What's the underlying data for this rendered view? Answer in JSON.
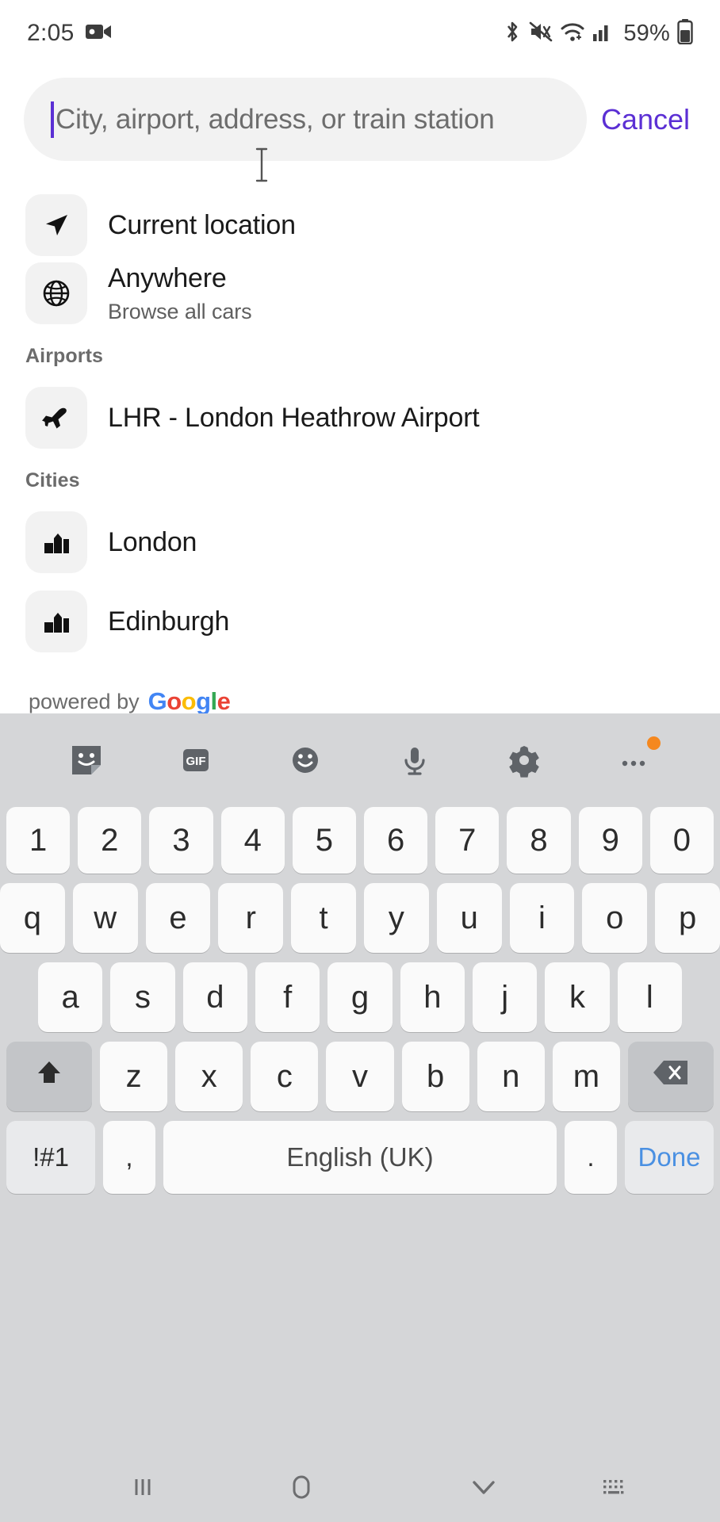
{
  "status_bar": {
    "time": "2:05",
    "recording_icon": "video-camera-icon",
    "icons": [
      "bluetooth-icon",
      "mute-icon",
      "wifi-icon",
      "cellular-signal-icon"
    ],
    "battery_percent": "59%"
  },
  "search": {
    "placeholder": "City, airport, address, or train station",
    "value": "",
    "cancel_label": "Cancel",
    "accent_color": "#5b2fd4"
  },
  "suggestions": {
    "current_location": {
      "label": "Current location",
      "icon": "navigation-arrow-icon"
    },
    "anywhere": {
      "label": "Anywhere",
      "sublabel": "Browse all cars",
      "icon": "globe-icon"
    },
    "sections": [
      {
        "header": "Airports",
        "items": [
          {
            "label": "LHR - London Heathrow Airport",
            "icon": "airplane-icon"
          }
        ]
      },
      {
        "header": "Cities",
        "items": [
          {
            "label": "London",
            "icon": "city-buildings-icon"
          },
          {
            "label": "Edinburgh",
            "icon": "city-buildings-icon"
          }
        ]
      }
    ],
    "powered_by": {
      "prefix": "powered by",
      "brand": "Google",
      "brand_letters": [
        "G",
        "o",
        "o",
        "g",
        "l",
        "e"
      ],
      "brand_colors": [
        "#4285F4",
        "#EA4335",
        "#FBBC05",
        "#4285F4",
        "#34A853",
        "#EA4335"
      ]
    }
  },
  "keyboard": {
    "toolbar": [
      "sticker-icon",
      "gif-icon",
      "emoji-icon",
      "microphone-icon",
      "settings-gear-icon",
      "overflow-menu-icon"
    ],
    "rows": {
      "numbers": [
        "1",
        "2",
        "3",
        "4",
        "5",
        "6",
        "7",
        "8",
        "9",
        "0"
      ],
      "top": [
        "q",
        "w",
        "e",
        "r",
        "t",
        "y",
        "u",
        "i",
        "o",
        "p"
      ],
      "home": [
        "a",
        "s",
        "d",
        "f",
        "g",
        "h",
        "j",
        "k",
        "l"
      ],
      "bottom": [
        "z",
        "x",
        "c",
        "v",
        "b",
        "n",
        "m"
      ]
    },
    "shift_icon": "shift-arrow-icon",
    "backspace_icon": "backspace-icon",
    "symbols_label": "!#1",
    "comma_label": ",",
    "space_label": "English (UK)",
    "period_label": ".",
    "done_label": "Done"
  },
  "navbar": {
    "recents": "recents-icon",
    "home": "home-icon",
    "dismiss": "chevron-down-icon",
    "keyboard_switch": "keyboard-switch-icon"
  }
}
